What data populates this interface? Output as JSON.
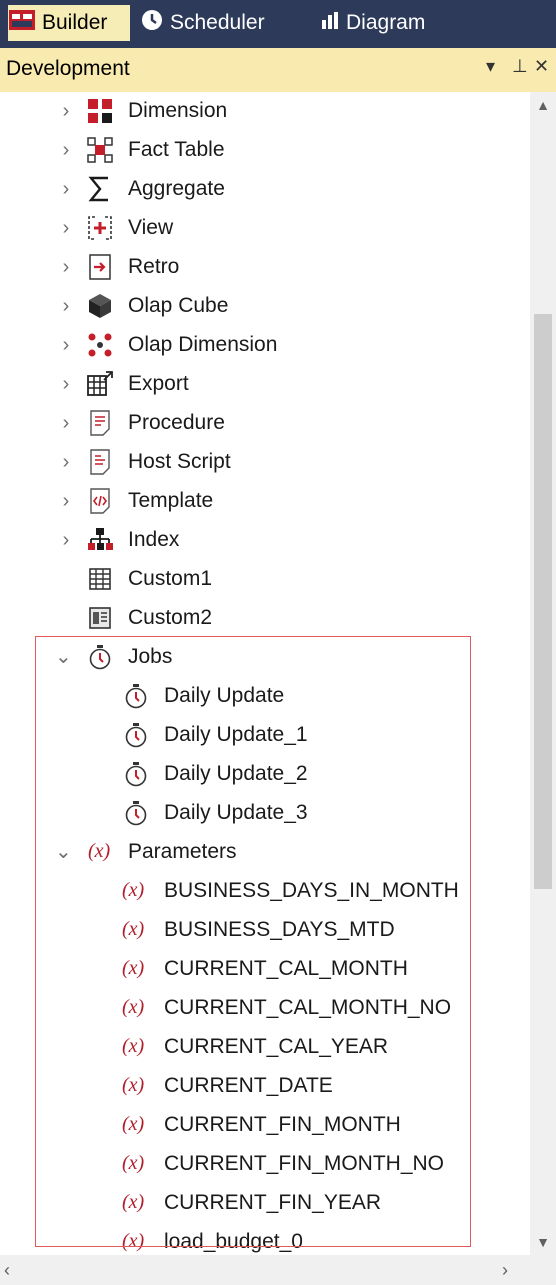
{
  "tabs": [
    {
      "label": "Builder",
      "icon": "builder-icon",
      "active": true
    },
    {
      "label": "Scheduler",
      "icon": "clock-icon",
      "active": false
    },
    {
      "label": "Diagram",
      "icon": "bar-chart-icon",
      "active": false
    }
  ],
  "panel": {
    "title": "Development",
    "buttons": {
      "dropdown": "▾",
      "pin": "⊥",
      "close": "✕"
    }
  },
  "tree": {
    "objects": [
      {
        "label": "Dimension",
        "icon": "dimension-icon"
      },
      {
        "label": "Fact Table",
        "icon": "fact-table-icon"
      },
      {
        "label": "Aggregate",
        "icon": "aggregate-icon"
      },
      {
        "label": "View",
        "icon": "view-icon"
      },
      {
        "label": "Retro",
        "icon": "retro-icon"
      },
      {
        "label": "Olap Cube",
        "icon": "olap-cube-icon"
      },
      {
        "label": "Olap Dimension",
        "icon": "olap-dimension-icon"
      },
      {
        "label": "Export",
        "icon": "export-icon"
      },
      {
        "label": "Procedure",
        "icon": "procedure-icon"
      },
      {
        "label": "Host Script",
        "icon": "host-script-icon"
      },
      {
        "label": "Template",
        "icon": "template-icon"
      },
      {
        "label": "Index",
        "icon": "index-icon"
      }
    ],
    "custom": [
      {
        "label": "Custom1",
        "icon": "grid-icon"
      },
      {
        "label": "Custom2",
        "icon": "form-icon"
      }
    ],
    "jobs": {
      "label": "Jobs",
      "icon": "stopwatch-icon",
      "items": [
        "Daily Update",
        "Daily Update_1",
        "Daily Update_2",
        "Daily Update_3"
      ]
    },
    "parameters": {
      "label": "Parameters",
      "symbol": "(x)",
      "items": [
        "BUSINESS_DAYS_IN_MONTH",
        "BUSINESS_DAYS_MTD",
        "CURRENT_CAL_MONTH",
        "CURRENT_CAL_MONTH_NO",
        "CURRENT_CAL_YEAR",
        "CURRENT_DATE",
        "CURRENT_FIN_MONTH",
        "CURRENT_FIN_MONTH_NO",
        "CURRENT_FIN_YEAR",
        "load_budget_0"
      ]
    }
  },
  "colors": {
    "tab_bar": "#2d3a5a",
    "active_tab": "#f6ecb6",
    "panel_header": "#f9ebb0",
    "icon_red": "#c41e2a",
    "highlight_border": "#e05a5a"
  }
}
